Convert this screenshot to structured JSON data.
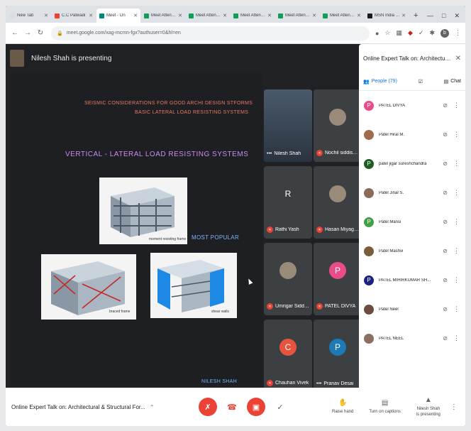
{
  "browser": {
    "tabs": [
      {
        "label": "New Tab",
        "color": "#dadce0",
        "active": false
      },
      {
        "label": "C.C Patwadi",
        "color": "#ea4335",
        "active": false
      },
      {
        "label": "Meet - On",
        "color": "#00897b",
        "active": true
      },
      {
        "label": "Meet Attendan",
        "color": "#0f9d58",
        "active": false
      },
      {
        "label": "Meet Attendan",
        "color": "#0f9d58",
        "active": false
      },
      {
        "label": "Meet Attendan",
        "color": "#0f9d58",
        "active": false
      },
      {
        "label": "Meet Attendan",
        "color": "#0f9d58",
        "active": false
      },
      {
        "label": "Meet Attendan",
        "color": "#0f9d58",
        "active": false
      },
      {
        "label": "MSN India | In",
        "color": "#1a1a1a",
        "active": false
      }
    ],
    "new_tab": "+",
    "url": "meet.google.com/xag-mcmn-fgx?authuser=0&hl=en"
  },
  "meet": {
    "presenting_text": "Nilesh Shah is presenting",
    "slide": {
      "title1": "SEISMIC CONSIDERATIONS FOR GOOD ARCHI DESIGN STFORMS",
      "title2": "BASIC LATERAL LOAD RESISTING SYSTEMS",
      "heading": "VERTICAL - LATERAL LOAD RESISTING SYSTEMS",
      "cap_moment": "moment resisting frame",
      "cap_braced": "braced frame",
      "cap_shear": "shear walls",
      "most_popular": "MOST POPULAR",
      "author": "NILESH SHAH"
    },
    "tiles": [
      {
        "name": "Nilesh Shah",
        "type": "video",
        "indicator": "dots"
      },
      {
        "name": "Nochil siddish...",
        "type": "photo",
        "indicator": "mic-off"
      },
      {
        "name": "Rathi Yash",
        "type": "letter",
        "letter": "R",
        "color": "#3c4043",
        "indicator": "mic-off"
      },
      {
        "name": "Hasan Miyaga...",
        "type": "photo",
        "indicator": "mic-off"
      },
      {
        "name": "Umrigar Siddha...",
        "type": "photo",
        "indicator": "mic-off"
      },
      {
        "name": "PATEL DIVYA",
        "type": "letter",
        "letter": "P",
        "color": "#e94c89",
        "indicator": "mic-off"
      },
      {
        "name": "Chauhan Vivek",
        "type": "letter",
        "letter": "C",
        "color": "#e8533d",
        "indicator": "mic-off"
      },
      {
        "name": "Pranav Desai",
        "type": "letter",
        "letter": "P",
        "color": "#1e7ab6",
        "indicator": "dots"
      }
    ]
  },
  "panel": {
    "title": "Online Expert Talk on: Architectural ...",
    "tab_people": "People (79)",
    "tab_chat": "Chat",
    "participants": [
      {
        "name": "PATEL DIVYA",
        "letter": "P",
        "color": "#e94c89"
      },
      {
        "name": "Patel Hiral M.",
        "letter": "",
        "color": "#a06a4f"
      },
      {
        "name": "patel jigar sureshchandra",
        "letter": "P",
        "color": "#1b5e20"
      },
      {
        "name": "Patel Jinal S.",
        "letter": "",
        "color": "#8a6b5a"
      },
      {
        "name": "Patel Mansi",
        "letter": "P",
        "color": "#43a047"
      },
      {
        "name": "Patel Mashvi",
        "letter": "",
        "color": "#7b5c3a"
      },
      {
        "name": "PATEL MIHIRKUMAR SH...",
        "letter": "P",
        "color": "#1a237e"
      },
      {
        "name": "Patel Neel",
        "letter": "",
        "color": "#6d4c41"
      },
      {
        "name": "PATEL NEEL",
        "letter": "",
        "color": "#8d6e63"
      }
    ]
  },
  "bottom": {
    "meeting_title": "Online Expert Talk on: Architectural & Structural For...",
    "raise_hand": "Raise hand",
    "captions": "Turn on captions",
    "presenting_line1": "Nilesh Shah",
    "presenting_line2": "is presenting"
  }
}
